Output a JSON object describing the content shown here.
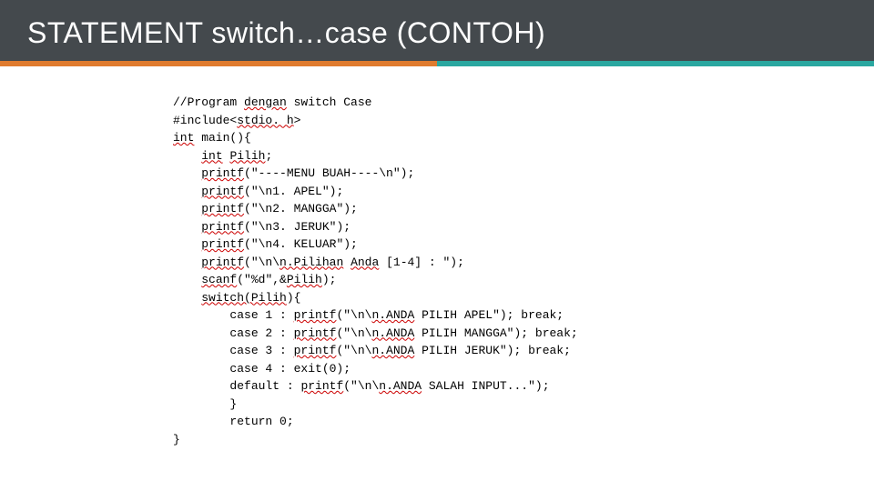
{
  "slide": {
    "title": "STATEMENT switch…case (CONTOH)"
  },
  "code": {
    "l1": "//Program ",
    "l1b": "dengan",
    "l1c": " switch Case",
    "l2": "#include<",
    "l2b": "stdio. h",
    "l2c": ">",
    "l3": "int",
    "l3b": " main(){",
    "l4": "    ",
    "l4a": "int",
    "l4b": " ",
    "l4c": "Pilih",
    "l4d": ";",
    "l5": "    ",
    "l5a": "printf",
    "l5b": "(\"----MENU BUAH----\\n\");",
    "l6": "    ",
    "l6a": "printf",
    "l6b": "(\"\\n1. APEL\");",
    "l7": "    ",
    "l7a": "printf",
    "l7b": "(\"\\n2. MANGGA\");",
    "l8": "    ",
    "l8a": "printf",
    "l8b": "(\"\\n3. JERUK\");",
    "l9": "    ",
    "l9a": "printf",
    "l9b": "(\"\\n4. KELUAR\");",
    "l10": "    ",
    "l10a": "printf",
    "l10b": "(\"\\n\\",
    "l10c": "n.Pilihan",
    "l10d": " ",
    "l10e": "Anda",
    "l10f": " [1-4] : \");",
    "l11": "    ",
    "l11a": "scanf",
    "l11b": "(\"%d\",&",
    "l11c": "Pilih",
    "l11d": ");",
    "l12": "    ",
    "l12a": "switch(Pilih",
    "l12b": "){",
    "l13": "        case 1 : ",
    "l13a": "printf",
    "l13b": "(\"\\n\\",
    "l13c": "n.ANDA",
    "l13d": " PILIH APEL\"); break;",
    "l14": "        case 2 : ",
    "l14a": "printf",
    "l14b": "(\"\\n\\",
    "l14c": "n.ANDA",
    "l14d": " PILIH MANGGA\"); break;",
    "l15": "        case 3 : ",
    "l15a": "printf",
    "l15b": "(\"\\n\\",
    "l15c": "n.ANDA",
    "l15d": " PILIH JERUK\"); break;",
    "l16": "        case 4 : exit(0);",
    "l17": "        default : ",
    "l17a": "printf",
    "l17b": "(\"\\n\\",
    "l17c": "n.ANDA",
    "l17d": " SALAH INPUT...\");",
    "l18": "        }",
    "l19": "        return 0;",
    "l20": "}"
  }
}
